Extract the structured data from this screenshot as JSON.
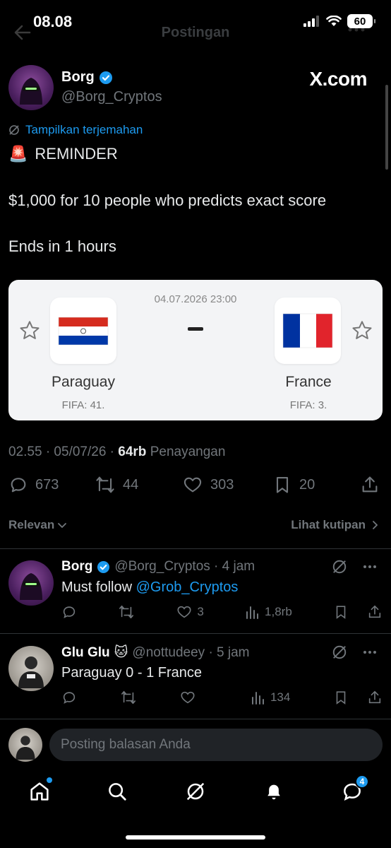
{
  "status_bar": {
    "time": "08.08",
    "battery": "60"
  },
  "header": {
    "title": "Postingan"
  },
  "post": {
    "author_name": "Borg",
    "author_handle": "@Borg_Cryptos",
    "watermark": "X.com",
    "translate_label": "Tampilkan terjemahan",
    "line1": "REMINDER",
    "line1_emoji": "🚨",
    "line2": "$1,000 for 10 people who predicts exact score",
    "line3": "Ends in 1 hours",
    "meta_time": "02.55 · 05/07/26 · ",
    "meta_views": "64rb",
    "meta_views_label": " Penayangan",
    "stats": {
      "replies": "673",
      "reposts": "44",
      "likes": "303",
      "bookmarks": "20"
    }
  },
  "match_card": {
    "date": "04.07.2026 23:00",
    "home": {
      "name": "Paraguay",
      "fifa": "FIFA: 41."
    },
    "away": {
      "name": "France",
      "fifa": "FIFA: 3."
    }
  },
  "filters": {
    "sort_label": "Relevan",
    "quotes_label": "Lihat kutipan"
  },
  "replies": [
    {
      "name": "Borg",
      "handle_time": "@Borg_Cryptos · 4 jam",
      "body_prefix": "Must follow ",
      "body_link": "@Grob_Cryptos",
      "likes": "3",
      "views": "1,8rb"
    },
    {
      "name": "Glu Glu",
      "name_emoji": "🐱",
      "handle_time": "@nottudeey · 5 jam",
      "body": "Paraguay 0 - 1 France",
      "views": "134"
    }
  ],
  "reply_box": {
    "placeholder": "Posting balasan Anda"
  },
  "tab_bar": {
    "messages_badge": "4"
  },
  "colors": {
    "accent": "#1d9bf0",
    "background": "#000000",
    "muted": "#71767b"
  }
}
